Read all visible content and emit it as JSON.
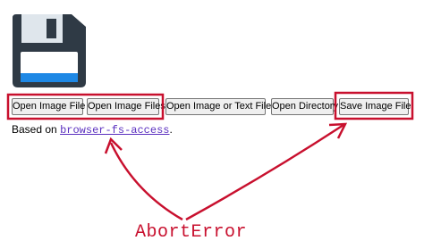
{
  "buttons": {
    "open_image_file": "Open Image File",
    "open_image_files": "Open Image Files",
    "open_image_or_text_files": "Open Image or Text Files",
    "open_directory": "Open Directory",
    "save_image_file": "Save Image File"
  },
  "credit": {
    "prefix": "Based on",
    "link_text": "browser-fs-access",
    "suffix": "."
  },
  "annotation": {
    "label": "AbortError",
    "color": "#c8102e"
  },
  "icons": {
    "app_icon": "floppy-disk-icon"
  }
}
